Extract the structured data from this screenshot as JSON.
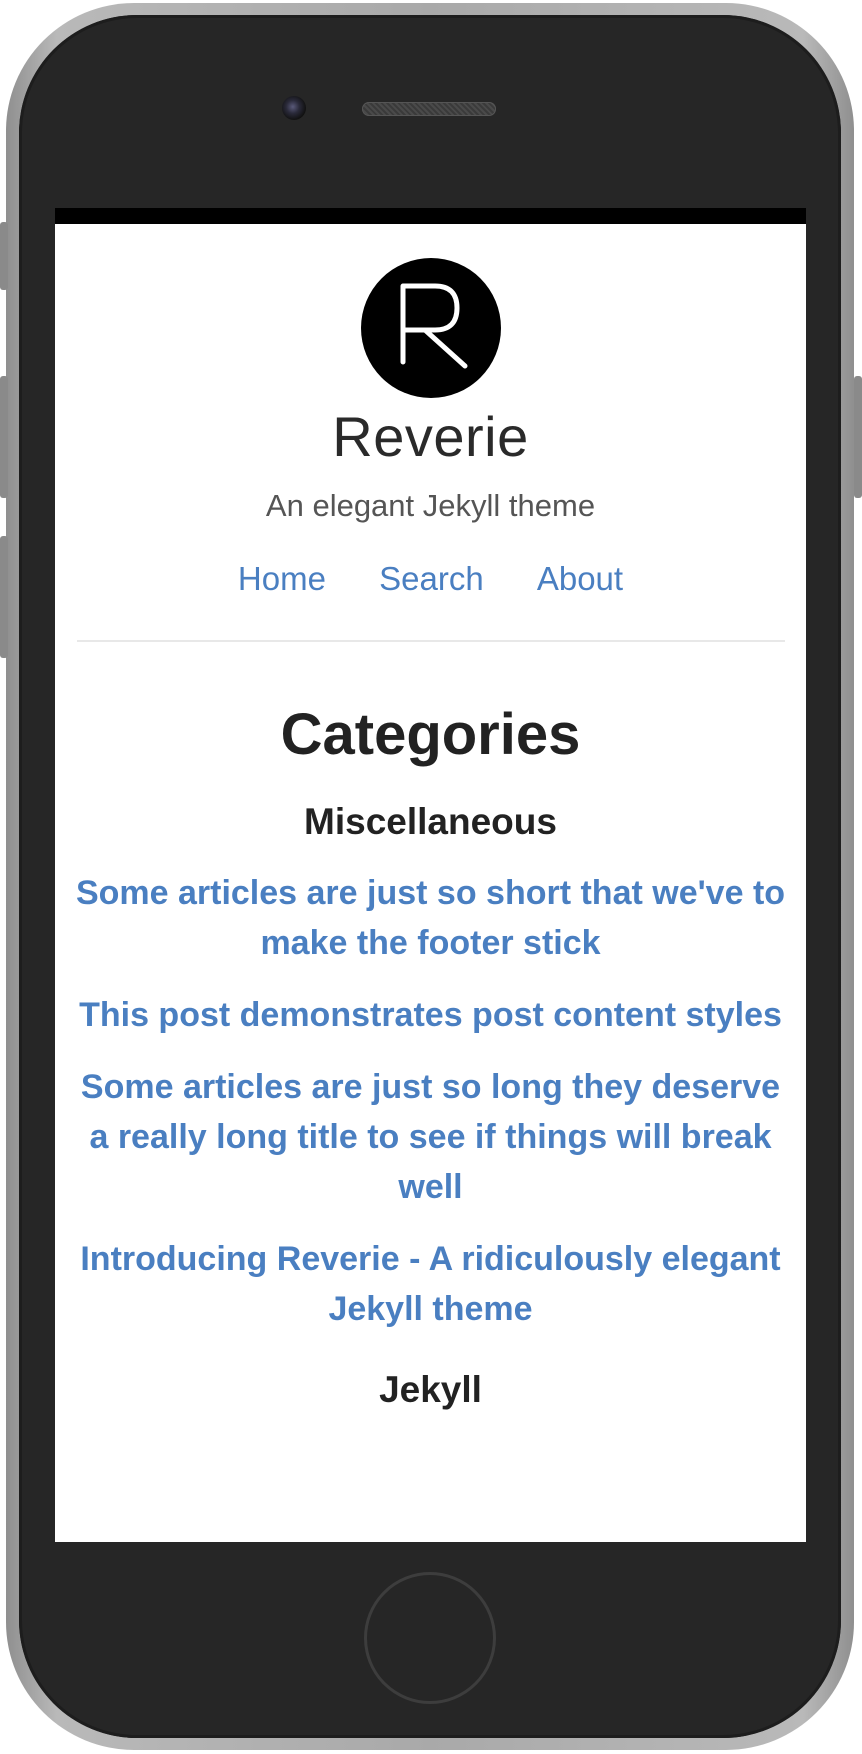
{
  "site": {
    "title": "Reverie",
    "description": "An elegant Jekyll theme",
    "logo_letter": "R"
  },
  "nav": {
    "items": [
      {
        "label": "Home"
      },
      {
        "label": "Search"
      },
      {
        "label": "About"
      }
    ]
  },
  "page": {
    "title": "Categories",
    "categories": [
      {
        "name": "Miscellaneous",
        "posts": [
          {
            "title": "Some articles are just so short that we've to make the footer stick"
          },
          {
            "title": "This post demonstrates post content styles"
          },
          {
            "title": "Some articles are just so long they deserve a really long title to see if things will break well"
          },
          {
            "title": "Introducing Reverie - A ridiculously elegant Jekyll theme"
          }
        ]
      },
      {
        "name": "Jekyll"
      }
    ]
  },
  "colors": {
    "link": "#4a7fc1",
    "heading": "#222222",
    "device": "#262626"
  }
}
